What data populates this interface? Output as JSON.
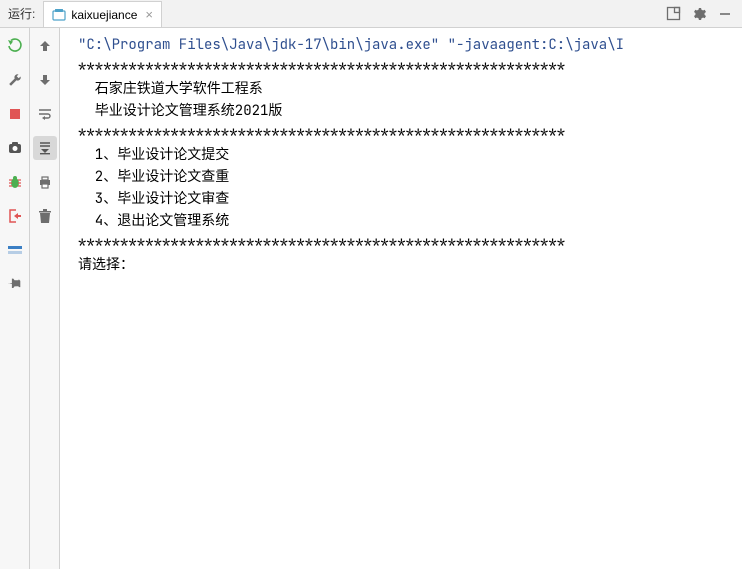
{
  "header": {
    "run_label": "运行:",
    "tab_name": "kaixuejiance"
  },
  "console": {
    "cmd": "\"C:\\Program Files\\Java\\jdk-17\\bin\\java.exe\" \"-javaagent:C:\\java\\I",
    "lines": [
      "**********************************************************",
      "  石家庄铁道大学软件工程系",
      "  毕业设计论文管理系统2021版",
      "**********************************************************",
      "  1、毕业设计论文提交",
      "  2、毕业设计论文查重",
      "  3、毕业设计论文审查",
      "  4、退出论文管理系统",
      "**********************************************************",
      "请选择："
    ]
  }
}
